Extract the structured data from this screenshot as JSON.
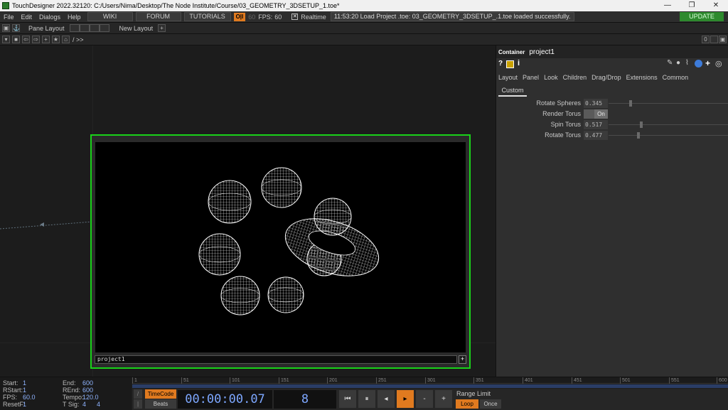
{
  "window": {
    "title": "TouchDesigner 2022.32120: C:/Users/Nima/Desktop/The Node Institute/Course/03_GEOMETRY_3DSETUP_1.toe*",
    "controls": [
      "—",
      "❐",
      "✕"
    ]
  },
  "menu": {
    "items": [
      "File",
      "Edit",
      "Dialogs",
      "Help"
    ],
    "wiki": "WIKI",
    "forum": "FORUM",
    "tutorials": "TUTORIALS",
    "oi_badge": "O|I",
    "fps_target": "60",
    "fps_label": "FPS:",
    "fps_value": "60",
    "realtime_label": "Realtime",
    "status": "11:53:20 Load Project .toe: 03_GEOMETRY_3DSETUP_.1.toe loaded successfully.",
    "update": "UPDATE"
  },
  "toolbar": {
    "pane_layout": "Pane Layout",
    "new_layout": "New Layout",
    "path": "/ >>",
    "right_count": "0"
  },
  "viewer": {
    "caption": "project1",
    "plus": "+"
  },
  "params": {
    "op_type": "Container",
    "op_name": "project1",
    "tabs": [
      "Layout",
      "Panel",
      "Look",
      "Children",
      "Drag/Drop",
      "Extensions",
      "Common"
    ],
    "active_tab": "Custom",
    "rows": [
      {
        "label": "Rotate Spheres",
        "value": "0.345",
        "fraction": 0.345
      },
      {
        "label": "Render Torus",
        "value": "On",
        "toggle": true
      },
      {
        "label": "Spin Torus",
        "value": "0.517",
        "fraction": 0.517
      },
      {
        "label": "Rotate Torus",
        "value": "0.477",
        "fraction": 0.477
      }
    ]
  },
  "timeline": {
    "stats": [
      {
        "k1": "Start:",
        "v1": "1",
        "k2": "End:",
        "v2": "600"
      },
      {
        "k1": "RStart:",
        "v1": "1",
        "k2": "REnd:",
        "v2": "600"
      },
      {
        "k1": "FPS:",
        "v1": "60.0",
        "k2": "Tempo:",
        "v2": "120.0"
      },
      {
        "k1": "ResetF:",
        "v1": "1",
        "k2": "T Sig:",
        "v2": "4      4"
      }
    ],
    "ruler": [
      "1",
      "51",
      "101",
      "151",
      "201",
      "251",
      "301",
      "351",
      "401",
      "451",
      "501",
      "551",
      "600"
    ],
    "timecode_btn": "TimeCode",
    "beats_btn": "Beats",
    "timecode": "00:00:00.07",
    "frame": "8",
    "range_limit": "Range Limit",
    "loop": "Loop",
    "once": "Once"
  },
  "colors": {
    "selection_green": "#19d219",
    "accent_orange": "#e07a1f",
    "timeline_blue": "#7da7ff"
  }
}
